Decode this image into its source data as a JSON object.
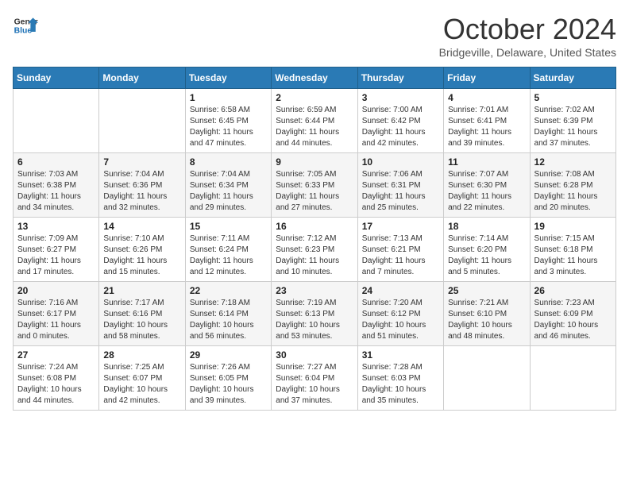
{
  "header": {
    "logo_line1": "General",
    "logo_line2": "Blue",
    "month_title": "October 2024",
    "location": "Bridgeville, Delaware, United States"
  },
  "weekdays": [
    "Sunday",
    "Monday",
    "Tuesday",
    "Wednesday",
    "Thursday",
    "Friday",
    "Saturday"
  ],
  "weeks": [
    [
      {
        "day": "",
        "info": ""
      },
      {
        "day": "",
        "info": ""
      },
      {
        "day": "1",
        "info": "Sunrise: 6:58 AM\nSunset: 6:45 PM\nDaylight: 11 hours and 47 minutes."
      },
      {
        "day": "2",
        "info": "Sunrise: 6:59 AM\nSunset: 6:44 PM\nDaylight: 11 hours and 44 minutes."
      },
      {
        "day": "3",
        "info": "Sunrise: 7:00 AM\nSunset: 6:42 PM\nDaylight: 11 hours and 42 minutes."
      },
      {
        "day": "4",
        "info": "Sunrise: 7:01 AM\nSunset: 6:41 PM\nDaylight: 11 hours and 39 minutes."
      },
      {
        "day": "5",
        "info": "Sunrise: 7:02 AM\nSunset: 6:39 PM\nDaylight: 11 hours and 37 minutes."
      }
    ],
    [
      {
        "day": "6",
        "info": "Sunrise: 7:03 AM\nSunset: 6:38 PM\nDaylight: 11 hours and 34 minutes."
      },
      {
        "day": "7",
        "info": "Sunrise: 7:04 AM\nSunset: 6:36 PM\nDaylight: 11 hours and 32 minutes."
      },
      {
        "day": "8",
        "info": "Sunrise: 7:04 AM\nSunset: 6:34 PM\nDaylight: 11 hours and 29 minutes."
      },
      {
        "day": "9",
        "info": "Sunrise: 7:05 AM\nSunset: 6:33 PM\nDaylight: 11 hours and 27 minutes."
      },
      {
        "day": "10",
        "info": "Sunrise: 7:06 AM\nSunset: 6:31 PM\nDaylight: 11 hours and 25 minutes."
      },
      {
        "day": "11",
        "info": "Sunrise: 7:07 AM\nSunset: 6:30 PM\nDaylight: 11 hours and 22 minutes."
      },
      {
        "day": "12",
        "info": "Sunrise: 7:08 AM\nSunset: 6:28 PM\nDaylight: 11 hours and 20 minutes."
      }
    ],
    [
      {
        "day": "13",
        "info": "Sunrise: 7:09 AM\nSunset: 6:27 PM\nDaylight: 11 hours and 17 minutes."
      },
      {
        "day": "14",
        "info": "Sunrise: 7:10 AM\nSunset: 6:26 PM\nDaylight: 11 hours and 15 minutes."
      },
      {
        "day": "15",
        "info": "Sunrise: 7:11 AM\nSunset: 6:24 PM\nDaylight: 11 hours and 12 minutes."
      },
      {
        "day": "16",
        "info": "Sunrise: 7:12 AM\nSunset: 6:23 PM\nDaylight: 11 hours and 10 minutes."
      },
      {
        "day": "17",
        "info": "Sunrise: 7:13 AM\nSunset: 6:21 PM\nDaylight: 11 hours and 7 minutes."
      },
      {
        "day": "18",
        "info": "Sunrise: 7:14 AM\nSunset: 6:20 PM\nDaylight: 11 hours and 5 minutes."
      },
      {
        "day": "19",
        "info": "Sunrise: 7:15 AM\nSunset: 6:18 PM\nDaylight: 11 hours and 3 minutes."
      }
    ],
    [
      {
        "day": "20",
        "info": "Sunrise: 7:16 AM\nSunset: 6:17 PM\nDaylight: 11 hours and 0 minutes."
      },
      {
        "day": "21",
        "info": "Sunrise: 7:17 AM\nSunset: 6:16 PM\nDaylight: 10 hours and 58 minutes."
      },
      {
        "day": "22",
        "info": "Sunrise: 7:18 AM\nSunset: 6:14 PM\nDaylight: 10 hours and 56 minutes."
      },
      {
        "day": "23",
        "info": "Sunrise: 7:19 AM\nSunset: 6:13 PM\nDaylight: 10 hours and 53 minutes."
      },
      {
        "day": "24",
        "info": "Sunrise: 7:20 AM\nSunset: 6:12 PM\nDaylight: 10 hours and 51 minutes."
      },
      {
        "day": "25",
        "info": "Sunrise: 7:21 AM\nSunset: 6:10 PM\nDaylight: 10 hours and 48 minutes."
      },
      {
        "day": "26",
        "info": "Sunrise: 7:23 AM\nSunset: 6:09 PM\nDaylight: 10 hours and 46 minutes."
      }
    ],
    [
      {
        "day": "27",
        "info": "Sunrise: 7:24 AM\nSunset: 6:08 PM\nDaylight: 10 hours and 44 minutes."
      },
      {
        "day": "28",
        "info": "Sunrise: 7:25 AM\nSunset: 6:07 PM\nDaylight: 10 hours and 42 minutes."
      },
      {
        "day": "29",
        "info": "Sunrise: 7:26 AM\nSunset: 6:05 PM\nDaylight: 10 hours and 39 minutes."
      },
      {
        "day": "30",
        "info": "Sunrise: 7:27 AM\nSunset: 6:04 PM\nDaylight: 10 hours and 37 minutes."
      },
      {
        "day": "31",
        "info": "Sunrise: 7:28 AM\nSunset: 6:03 PM\nDaylight: 10 hours and 35 minutes."
      },
      {
        "day": "",
        "info": ""
      },
      {
        "day": "",
        "info": ""
      }
    ]
  ]
}
